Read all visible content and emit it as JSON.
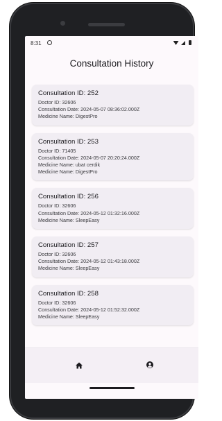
{
  "status_bar": {
    "time": "8:31"
  },
  "header": {
    "title": "Consultation History"
  },
  "consultations": [
    {
      "title": "Consultation ID: 252",
      "lines": [
        "Doctor ID: 32606",
        "Consultation Date: 2024-05-07 08:36:02.000Z",
        "Medicine Name: DigestPro"
      ]
    },
    {
      "title": "Consultation ID: 253",
      "lines": [
        "Doctor ID: 71405",
        "Consultation Date: 2024-05-07 20:20:24.000Z",
        "Medicine Name: ubat cerdik",
        "Medicine Name: DigestPro"
      ]
    },
    {
      "title": "Consultation ID: 256",
      "lines": [
        "Doctor ID: 32606",
        "Consultation Date: 2024-05-12 01:32:16.000Z",
        "Medicine Name: SleepEasy"
      ]
    },
    {
      "title": "Consultation ID: 257",
      "lines": [
        "Doctor ID: 32606",
        "Consultation Date: 2024-05-12 01:43:18.000Z",
        "Medicine Name: SleepEasy"
      ]
    },
    {
      "title": "Consultation ID: 258",
      "lines": [
        "Doctor ID: 32606",
        "Consultation Date: 2024-05-12 01:52:32.000Z",
        "Medicine Name: SleepEasy"
      ]
    }
  ],
  "bottom_nav": {
    "items": [
      {
        "icon": "home-icon"
      },
      {
        "icon": "account-circle-icon"
      }
    ]
  },
  "colors": {
    "screen_background": "#fdf9fc",
    "card_background": "#f1edf3",
    "nav_background": "#f4eff5"
  }
}
